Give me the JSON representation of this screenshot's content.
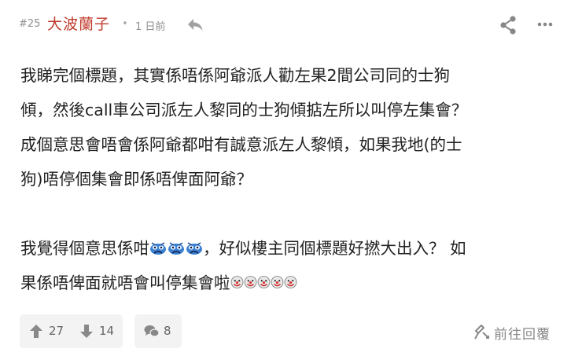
{
  "post": {
    "number": "#25",
    "author": "大波蘭子",
    "separator": "•",
    "time": "1 日前"
  },
  "icons": {
    "reply": "reply-arrow-icon",
    "share": "share-icon",
    "more": "more-dots-icon",
    "upvote": "arrow-up-icon",
    "downvote": "arrow-down-icon",
    "comments": "comment-bubbles-icon",
    "goto_reply": "goto-reply-icon",
    "emoji_group_1": "blue-crying-face-emoji",
    "emoji_group_2": "clown-face-emoji"
  },
  "content": {
    "line1": "我睇完個標題，其實係唔係阿爺派人勸左果2間公司同的士狗",
    "line2": "傾，然後call車公司派左人黎同的士狗傾掂左所以叫停左集會？",
    "line3": "成個意思會唔會係阿爺都咁有誠意派左人黎傾，如果我地(的士",
    "line4": "狗)唔停個集會即係唔俾面阿爺？",
    "line5_before": "我覺得個意思係咁",
    "line5_after": "，好似樓主同個標題好撚大出入？ 如",
    "line6": "果係唔俾面就唔會叫停集會啦"
  },
  "footer": {
    "upvotes": "27",
    "downvotes": "14",
    "comments": "8",
    "goto_label": "前往回覆"
  },
  "colors": {
    "author": "#c0392b",
    "muted": "#8f8f8f",
    "button_bg": "#f3f3f3"
  }
}
